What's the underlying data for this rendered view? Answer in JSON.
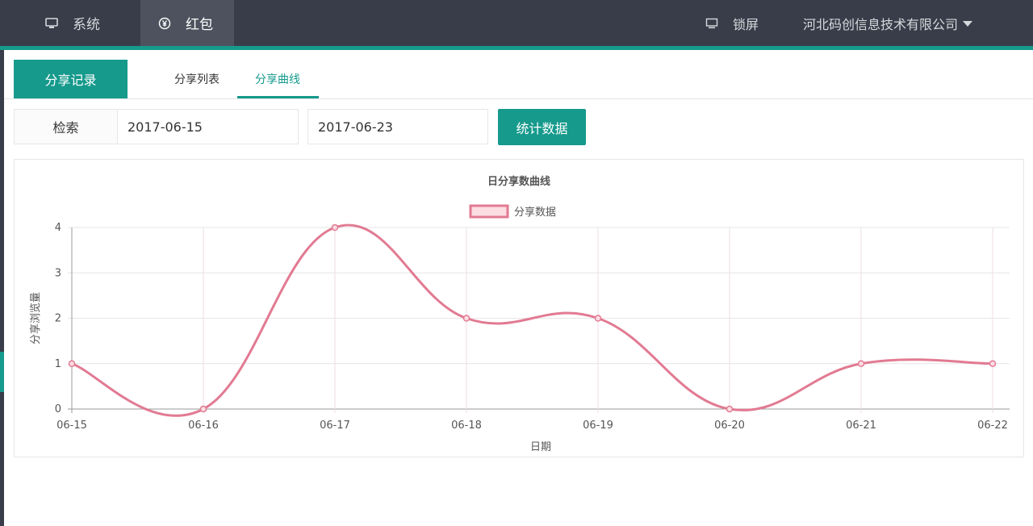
{
  "nav": {
    "items": [
      {
        "label": "系统",
        "icon": "monitor-icon"
      },
      {
        "label": "红包",
        "icon": "yen-icon"
      }
    ],
    "lock_label": "锁屏",
    "company": "河北码创信息技术有限公司"
  },
  "tabs": {
    "main_label": "分享记录",
    "sub": [
      {
        "label": "分享列表"
      },
      {
        "label": "分享曲线"
      }
    ],
    "active_sub_index": 1
  },
  "search": {
    "label": "检索",
    "start_date": "2017-06-15",
    "end_date": "2017-06-23",
    "button_label": "统计数据"
  },
  "colors": {
    "accent": "#169a8c",
    "topbar": "#393d49",
    "series_line": "#e27a92",
    "series_fill": "#fbdde3"
  },
  "chart_data": {
    "type": "line",
    "title": "日分享数曲线",
    "xlabel": "日期",
    "ylabel": "分享浏览量",
    "categories": [
      "06-15",
      "06-16",
      "06-17",
      "06-18",
      "06-19",
      "06-20",
      "06-21",
      "06-22"
    ],
    "series": [
      {
        "name": "分享数据",
        "values": [
          1,
          0,
          4,
          2,
          2,
          0,
          1,
          1
        ]
      }
    ],
    "ylim": [
      0,
      4
    ],
    "yticks": [
      0,
      1,
      2,
      3,
      4
    ],
    "grid": true,
    "legend": "top-center",
    "smooth": true
  }
}
